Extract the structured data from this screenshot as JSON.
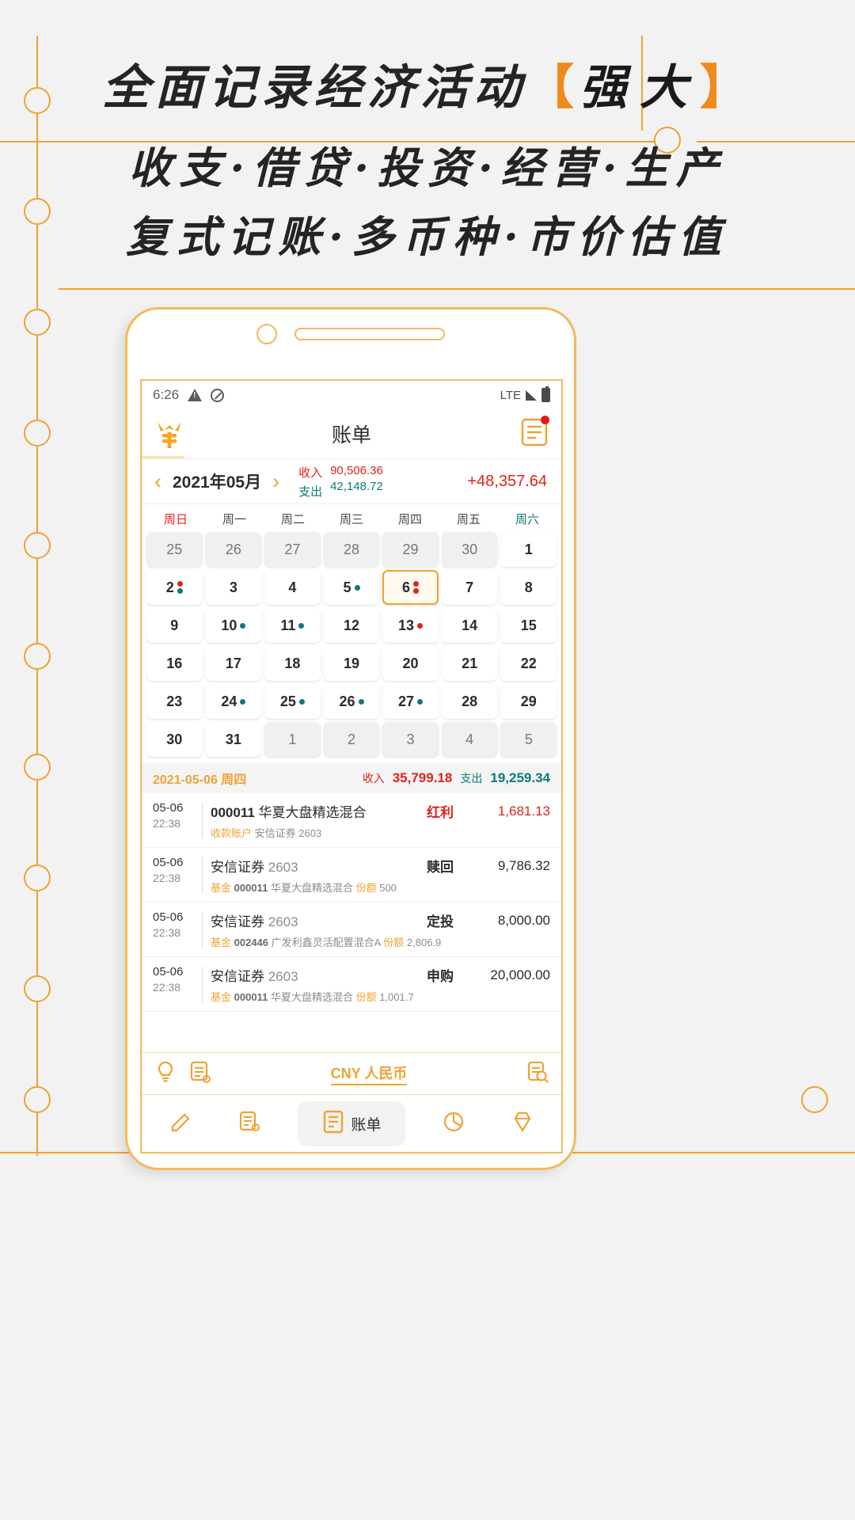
{
  "banner": {
    "line1_text": "全面记录经济活动",
    "line1_bracket_open": "【",
    "line1_strong": "强大",
    "line1_bracket_close": "】",
    "line2": "收支·借贷·投资·经营·生产",
    "line3": "复式记账·多币种·市价估值"
  },
  "statusbar": {
    "time": "6:26",
    "warning_icon": "warning-triangle-icon",
    "dnd_icon": "do-not-disturb-icon",
    "network": "LTE",
    "signal_icon": "signal-no-service-icon",
    "battery_icon": "battery-full-icon"
  },
  "appbar": {
    "logo": "yuan-logo-icon",
    "title": "账单",
    "right_icon": "bill-document-icon",
    "badge": true
  },
  "monthbar": {
    "prev": "‹",
    "month": "2021年05月",
    "next": "›",
    "income_label": "收入",
    "income_value": "90,506.36",
    "expense_label": "支出",
    "expense_value": "42,148.72",
    "net": "+48,357.64"
  },
  "calendar": {
    "weekdays": [
      "周日",
      "周一",
      "周二",
      "周三",
      "周四",
      "周五",
      "周六"
    ],
    "weeks": [
      [
        {
          "d": "25",
          "muted": true,
          "dots": []
        },
        {
          "d": "26",
          "muted": true,
          "dots": []
        },
        {
          "d": "27",
          "muted": true,
          "dots": []
        },
        {
          "d": "28",
          "muted": true,
          "dots": []
        },
        {
          "d": "29",
          "muted": true,
          "dots": []
        },
        {
          "d": "30",
          "muted": true,
          "dots": []
        },
        {
          "d": "1",
          "muted": false,
          "dots": []
        }
      ],
      [
        {
          "d": "2",
          "muted": false,
          "dots": [
            "r",
            "g"
          ]
        },
        {
          "d": "3",
          "muted": false,
          "dots": []
        },
        {
          "d": "4",
          "muted": false,
          "dots": []
        },
        {
          "d": "5",
          "muted": false,
          "dots": [
            "g"
          ]
        },
        {
          "d": "6",
          "muted": false,
          "dots": [
            "r",
            "r"
          ],
          "selected": true
        },
        {
          "d": "7",
          "muted": false,
          "dots": []
        },
        {
          "d": "8",
          "muted": false,
          "dots": []
        }
      ],
      [
        {
          "d": "9",
          "muted": false,
          "dots": []
        },
        {
          "d": "10",
          "muted": false,
          "dots": [
            "g"
          ]
        },
        {
          "d": "11",
          "muted": false,
          "dots": [
            "g"
          ]
        },
        {
          "d": "12",
          "muted": false,
          "dots": []
        },
        {
          "d": "13",
          "muted": false,
          "dots": [
            "r"
          ]
        },
        {
          "d": "14",
          "muted": false,
          "dots": []
        },
        {
          "d": "15",
          "muted": false,
          "dots": []
        }
      ],
      [
        {
          "d": "16",
          "muted": false,
          "dots": []
        },
        {
          "d": "17",
          "muted": false,
          "dots": []
        },
        {
          "d": "18",
          "muted": false,
          "dots": []
        },
        {
          "d": "19",
          "muted": false,
          "dots": []
        },
        {
          "d": "20",
          "muted": false,
          "dots": []
        },
        {
          "d": "21",
          "muted": false,
          "dots": []
        },
        {
          "d": "22",
          "muted": false,
          "dots": []
        }
      ],
      [
        {
          "d": "23",
          "muted": false,
          "dots": []
        },
        {
          "d": "24",
          "muted": false,
          "dots": [
            "g"
          ]
        },
        {
          "d": "25",
          "muted": false,
          "dots": [
            "g"
          ]
        },
        {
          "d": "26",
          "muted": false,
          "dots": [
            "g"
          ]
        },
        {
          "d": "27",
          "muted": false,
          "dots": [
            "g"
          ]
        },
        {
          "d": "28",
          "muted": false,
          "dots": []
        },
        {
          "d": "29",
          "muted": false,
          "dots": []
        }
      ],
      [
        {
          "d": "30",
          "muted": false,
          "dots": []
        },
        {
          "d": "31",
          "muted": false,
          "dots": []
        },
        {
          "d": "1",
          "muted": true,
          "dots": []
        },
        {
          "d": "2",
          "muted": true,
          "dots": []
        },
        {
          "d": "3",
          "muted": true,
          "dots": []
        },
        {
          "d": "4",
          "muted": true,
          "dots": []
        },
        {
          "d": "5",
          "muted": true,
          "dots": []
        }
      ]
    ]
  },
  "daybar": {
    "date": "2021-05-06 周四",
    "income_label": "收入",
    "income_value": "35,799.18",
    "expense_label": "支出",
    "expense_value": "19,259.34"
  },
  "transactions": [
    {
      "date": "05-06",
      "time": "22:38",
      "code": "000011",
      "name": "华夏大盘精选混合",
      "sub_tag": "收款账户",
      "sub_text": "安信证券 2603",
      "sub_code": "",
      "sub_name": "",
      "sub_tag2": "",
      "sub_value": "",
      "type": "红利",
      "type_color": "red",
      "amount": "1,681.13",
      "amount_color": "red"
    },
    {
      "date": "05-06",
      "time": "22:38",
      "code": "",
      "name": "安信证券",
      "name_gray": "2603",
      "sub_tag": "基金",
      "sub_code": "000011",
      "sub_name": "华夏大盘精选混合",
      "sub_tag2": "份额",
      "sub_value": "500",
      "type": "赎回",
      "type_color": "dark",
      "amount": "9,786.32",
      "amount_color": "dark"
    },
    {
      "date": "05-06",
      "time": "22:38",
      "code": "",
      "name": "安信证券",
      "name_gray": "2603",
      "sub_tag": "基金",
      "sub_code": "002446",
      "sub_name": "广发利鑫灵活配置混合A",
      "sub_tag2": "份额",
      "sub_value": "2,806.9",
      "type": "定投",
      "type_color": "dark",
      "amount": "8,000.00",
      "amount_color": "dark"
    },
    {
      "date": "05-06",
      "time": "22:38",
      "code": "",
      "name": "安信证券",
      "name_gray": "2603",
      "sub_tag": "基金",
      "sub_code": "000011",
      "sub_name": "华夏大盘精选混合",
      "sub_tag2": "份额",
      "sub_value": "1,001.7",
      "type": "申购",
      "type_color": "dark",
      "amount": "20,000.00",
      "amount_color": "dark"
    }
  ],
  "currencybar": {
    "bulb_icon": "lightbulb-icon",
    "note_icon": "note-edit-icon",
    "label": "CNY 人民币",
    "search_icon": "document-search-icon"
  },
  "bottomnav": [
    {
      "icon": "edit-pencil-icon",
      "label": ""
    },
    {
      "icon": "ledger-icon",
      "label": ""
    },
    {
      "icon": "bill-icon",
      "label": "账单",
      "active": true
    },
    {
      "icon": "pie-chart-icon",
      "label": ""
    },
    {
      "icon": "diamond-icon",
      "label": ""
    }
  ],
  "colors": {
    "accent": "#f0a232",
    "income": "#e2231a",
    "expense": "#0d7a78"
  }
}
